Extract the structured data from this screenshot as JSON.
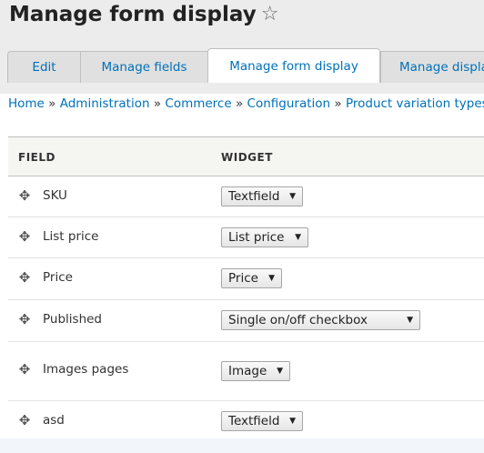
{
  "page": {
    "title": "Manage form display",
    "star": "☆"
  },
  "tabs": [
    {
      "label": "Edit"
    },
    {
      "label": "Manage fields"
    },
    {
      "label": "Manage form display"
    },
    {
      "label": "Manage displa"
    }
  ],
  "breadcrumb": {
    "items": [
      "Home",
      "Administration",
      "Commerce",
      "Configuration",
      "Product variation types"
    ],
    "separator": "»"
  },
  "table": {
    "headers": {
      "field": "FIELD",
      "widget": "WIDGET"
    },
    "rows": [
      {
        "field": "SKU",
        "widget": "Textfield"
      },
      {
        "field": "List price",
        "widget": "List price"
      },
      {
        "field": "Price",
        "widget": "Price"
      },
      {
        "field": "Published",
        "widget": "Single on/off checkbox"
      },
      {
        "field": "Images pages",
        "widget": "Image"
      },
      {
        "field": "asd",
        "widget": "Textfield"
      }
    ]
  },
  "icons": {
    "drag_handle": "drag-handle-icon",
    "dropdown_arrow": "chevron-down-icon",
    "star": "star-outline-icon"
  },
  "colors": {
    "link": "#0071b8",
    "header_bg": "#ececec",
    "table_header_bg": "#f5f5f2"
  }
}
